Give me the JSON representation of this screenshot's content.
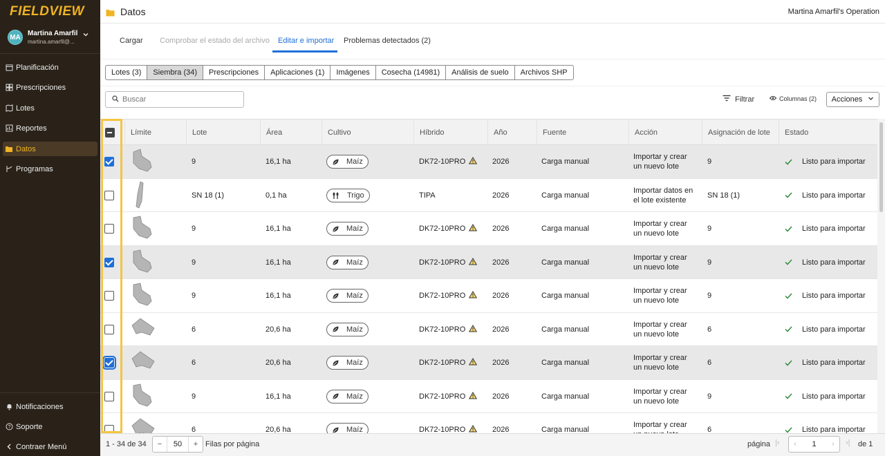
{
  "app": {
    "logo": "FIELDVIEW"
  },
  "user": {
    "initials": "MA",
    "name": "Martina Amarfil",
    "email": "martina.amarfil@..."
  },
  "sidebar": {
    "items": [
      {
        "label": "Planificación",
        "icon": "calendar-icon"
      },
      {
        "label": "Prescripciones",
        "icon": "grid-icon"
      },
      {
        "label": "Lotes",
        "icon": "map-icon"
      },
      {
        "label": "Reportes",
        "icon": "report-icon"
      },
      {
        "label": "Datos",
        "icon": "folder-icon",
        "active": true
      },
      {
        "label": "Programas",
        "icon": "branch-icon"
      }
    ],
    "bottom": [
      {
        "label": "Notificaciones",
        "icon": "bell-icon"
      },
      {
        "label": "Soporte",
        "icon": "help-icon"
      },
      {
        "label": "Contraer Menú",
        "icon": "collapse-icon"
      }
    ]
  },
  "header": {
    "title": "Datos",
    "operation": "Martina Amarfil's Operation"
  },
  "steps": [
    {
      "label": "Cargar",
      "state": "normal"
    },
    {
      "label": "Comprobar el estado del archivo",
      "state": "disabled"
    },
    {
      "label": "Editar e importar",
      "state": "active"
    },
    {
      "label": "Problemas detectados (2)",
      "state": "normal"
    }
  ],
  "type_tabs": [
    "Lotes (3)",
    "Siembra (34)",
    "Prescripciones",
    "Aplicaciones (1)",
    "Imágenes",
    "Cosecha (14981)",
    "Análisis de suelo",
    "Archivos SHP"
  ],
  "toolbar": {
    "search_placeholder": "Buscar",
    "filter": "Filtrar",
    "columns": "Columnas (2)",
    "actions": "Acciones"
  },
  "table": {
    "columns": [
      "Límite",
      "Lote",
      "Área",
      "Cultivo",
      "Híbrido",
      "Año",
      "Fuente",
      "Acción",
      "Asignación de lote",
      "Estado"
    ],
    "rows": [
      {
        "checked": true,
        "lote": "9",
        "area": "16,1 ha",
        "cultivo": "Maíz",
        "hibrido": "DK72-10PRO",
        "warn": true,
        "anio": "2026",
        "fuente": "Carga manual",
        "accion1": "Importar y crear",
        "accion2": "un nuevo lote",
        "asignacion": "9",
        "estado": "Listo para importar"
      },
      {
        "checked": false,
        "lote": "SN 18 (1)",
        "area": "0,1 ha",
        "cultivo": "Trigo",
        "hibrido": "TIPA",
        "warn": false,
        "anio": "2026",
        "fuente": "Carga manual",
        "accion1": "Importar datos en",
        "accion2": "el lote existente",
        "asignacion": "SN 18 (1)",
        "estado": "Listo para importar"
      },
      {
        "checked": false,
        "lote": "9",
        "area": "16,1 ha",
        "cultivo": "Maíz",
        "hibrido": "DK72-10PRO",
        "warn": true,
        "anio": "2026",
        "fuente": "Carga manual",
        "accion1": "Importar y crear",
        "accion2": "un nuevo lote",
        "asignacion": "9",
        "estado": "Listo para importar"
      },
      {
        "checked": true,
        "lote": "9",
        "area": "16,1 ha",
        "cultivo": "Maíz",
        "hibrido": "DK72-10PRO",
        "warn": true,
        "anio": "2026",
        "fuente": "Carga manual",
        "accion1": "Importar y crear",
        "accion2": "un nuevo lote",
        "asignacion": "9",
        "estado": "Listo para importar"
      },
      {
        "checked": false,
        "lote": "9",
        "area": "16,1 ha",
        "cultivo": "Maíz",
        "hibrido": "DK72-10PRO",
        "warn": true,
        "anio": "2026",
        "fuente": "Carga manual",
        "accion1": "Importar y crear",
        "accion2": "un nuevo lote",
        "asignacion": "9",
        "estado": "Listo para importar"
      },
      {
        "checked": false,
        "lote": "6",
        "area": "20,6 ha",
        "cultivo": "Maíz",
        "hibrido": "DK72-10PRO",
        "warn": true,
        "anio": "2026",
        "fuente": "Carga manual",
        "accion1": "Importar y crear",
        "accion2": "un nuevo lote",
        "asignacion": "6",
        "estado": "Listo para importar"
      },
      {
        "checked": true,
        "focus": true,
        "lote": "6",
        "area": "20,6 ha",
        "cultivo": "Maíz",
        "hibrido": "DK72-10PRO",
        "warn": true,
        "anio": "2026",
        "fuente": "Carga manual",
        "accion1": "Importar y crear",
        "accion2": "un nuevo lote",
        "asignacion": "6",
        "estado": "Listo para importar"
      },
      {
        "checked": false,
        "lote": "9",
        "area": "16,1 ha",
        "cultivo": "Maíz",
        "hibrido": "DK72-10PRO",
        "warn": true,
        "anio": "2026",
        "fuente": "Carga manual",
        "accion1": "Importar y crear",
        "accion2": "un nuevo lote",
        "asignacion": "9",
        "estado": "Listo para importar"
      },
      {
        "checked": false,
        "lote": "6",
        "area": "20,6 ha",
        "cultivo": "Maíz",
        "hibrido": "DK72-10PRO",
        "warn": true,
        "anio": "2026",
        "fuente": "Carga manual",
        "accion1": "Importar y crear",
        "accion2": "un nuevo lote",
        "asignacion": "6",
        "estado": "Listo para importar"
      }
    ]
  },
  "footer": {
    "range": "1 - 34 de 34",
    "per_page": "50",
    "per_page_label": "Filas por página",
    "page_label": "página",
    "page": "1",
    "of_label": "de 1"
  },
  "colors": {
    "accent": "#1f6fd8",
    "sidebar_bg": "#2a2219",
    "brand": "#f0b323",
    "highlight": "#f5c542",
    "success": "#2e8b3a",
    "warning": "#c98a00"
  }
}
